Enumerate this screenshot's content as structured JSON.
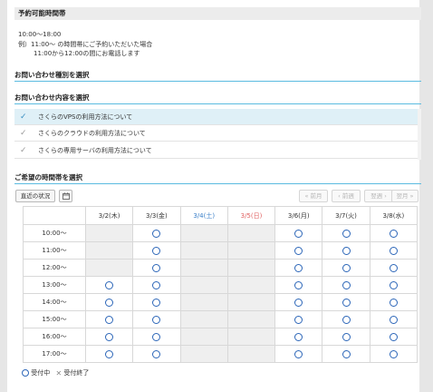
{
  "hours": {
    "heading": "予約可能時間帯",
    "lines": [
      "10:00～18:00",
      "例）11:00～ の時間帯にご予約いただいた場合",
      "11:00から12:00の間にお電話します"
    ]
  },
  "inquiry_type": {
    "heading": "お問い合わせ種別を選択"
  },
  "inquiry_content": {
    "heading": "お問い合わせ内容を選択",
    "options": [
      {
        "label": "さくらのVPSの利用方法について",
        "selected": true
      },
      {
        "label": "さくらのクラウドの利用方法について",
        "selected": false
      },
      {
        "label": "さくらの専用サーバの利用方法について",
        "selected": false
      }
    ]
  },
  "schedule": {
    "heading": "ご希望の時間帯を選択",
    "recent_button": "直近の状況",
    "calendar_icon": "calendar-icon",
    "nav": {
      "prev_month": "« 前月",
      "prev_week": "‹ 前週",
      "next_week": "翌週 ›",
      "next_month": "翌月 »"
    },
    "days": [
      {
        "label": "3/2(木)",
        "kind": "weekday"
      },
      {
        "label": "3/3(金)",
        "kind": "weekday"
      },
      {
        "label": "3/4(土)",
        "kind": "sat"
      },
      {
        "label": "3/5(日)",
        "kind": "sun"
      },
      {
        "label": "3/6(月)",
        "kind": "weekday"
      },
      {
        "label": "3/7(火)",
        "kind": "weekday"
      },
      {
        "label": "3/8(水)",
        "kind": "weekday"
      }
    ],
    "slots": [
      {
        "time": "10:00～",
        "cells": [
          "na",
          "o",
          "na",
          "na",
          "o",
          "o",
          "o"
        ]
      },
      {
        "time": "11:00～",
        "cells": [
          "na",
          "o",
          "na",
          "na",
          "o",
          "o",
          "o"
        ]
      },
      {
        "time": "12:00～",
        "cells": [
          "na",
          "o",
          "na",
          "na",
          "o",
          "o",
          "o"
        ]
      },
      {
        "time": "13:00～",
        "cells": [
          "o",
          "o",
          "na",
          "na",
          "o",
          "o",
          "o"
        ]
      },
      {
        "time": "14:00～",
        "cells": [
          "o",
          "o",
          "na",
          "na",
          "o",
          "o",
          "o"
        ]
      },
      {
        "time": "15:00～",
        "cells": [
          "o",
          "o",
          "na",
          "na",
          "o",
          "o",
          "o"
        ]
      },
      {
        "time": "16:00～",
        "cells": [
          "o",
          "o",
          "na",
          "na",
          "o",
          "o",
          "o"
        ]
      },
      {
        "time": "17:00～",
        "cells": [
          "o",
          "o",
          "na",
          "na",
          "o",
          "o",
          "o"
        ]
      }
    ],
    "legend": {
      "open": "受付中",
      "closed": "受付終了"
    }
  },
  "colors": {
    "accent_line": "#5bbbe0",
    "circle": "#2c66b8",
    "saturday": "#3a7fc8",
    "sunday": "#e06060",
    "selected_row": "#dff0f7"
  }
}
